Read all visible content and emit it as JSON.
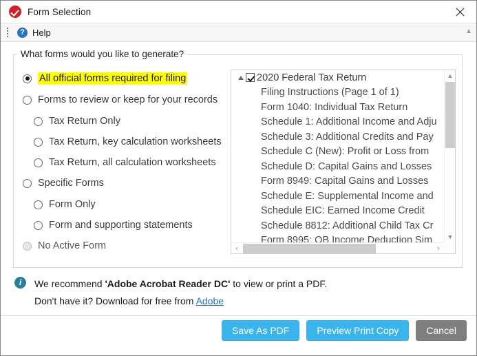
{
  "window": {
    "title": "Form Selection",
    "title_icon": "red-check-circle-icon",
    "close_icon": "close-icon"
  },
  "toolbar": {
    "grip_icon": "drag-grip-icon",
    "help_icon": "help-question-icon",
    "help_label": "Help",
    "collapse_icon": "chevron-up-icon"
  },
  "group": {
    "legend": "What forms would you like to generate?",
    "options": [
      {
        "label": "All official forms required for filing",
        "selected": true,
        "highlighted": true,
        "level": 0,
        "disabled": false
      },
      {
        "label": "Forms to review or keep for your records",
        "selected": false,
        "highlighted": false,
        "level": 0,
        "disabled": false
      },
      {
        "label": "Tax Return Only",
        "selected": false,
        "highlighted": false,
        "level": 1,
        "disabled": false
      },
      {
        "label": "Tax Return, key calculation worksheets",
        "selected": false,
        "highlighted": false,
        "level": 1,
        "disabled": false
      },
      {
        "label": "Tax Return, all calculation worksheets",
        "selected": false,
        "highlighted": false,
        "level": 1,
        "disabled": false
      },
      {
        "label": "Specific Forms",
        "selected": false,
        "highlighted": false,
        "level": 0,
        "disabled": false
      },
      {
        "label": "Form Only",
        "selected": false,
        "highlighted": false,
        "level": 1,
        "disabled": false
      },
      {
        "label": "Form and supporting statements",
        "selected": false,
        "highlighted": false,
        "level": 1,
        "disabled": false
      },
      {
        "label": "No Active Form",
        "selected": false,
        "highlighted": false,
        "level": 0,
        "disabled": true
      }
    ]
  },
  "forms_list": {
    "root": {
      "label": "2020 Federal Tax Return",
      "checked": true,
      "expanded": true,
      "expander_icon": "triangle-down-icon",
      "checkbox_icon": "checkbox-checked-icon"
    },
    "items": [
      "Filing Instructions (Page 1 of 1)",
      "Form 1040: Individual Tax Return",
      "Schedule 1: Additional Income and Adju",
      "Schedule 3: Additional Credits and Pay",
      "Schedule C (New): Profit or Loss from ",
      "Schedule D: Capital Gains and Losses",
      "Form 8949: Capital Gains and Losses",
      "Schedule E: Supplemental Income and",
      "Schedule EIC: Earned Income Credit",
      "Schedule 8812: Additional Child Tax Cr",
      "Form 8995: QB Income Deduction Sim"
    ],
    "scroll": {
      "up_icon": "scroll-up-arrow-icon",
      "down_icon": "scroll-down-arrow-icon",
      "left_icon": "scroll-left-arrow-icon",
      "right_icon": "scroll-right-arrow-icon"
    }
  },
  "info": {
    "icon": "info-icon",
    "line1_pre": "We recommend ",
    "line1_bold": "'Adobe Acrobat Reader DC'",
    "line1_post": " to view or print a PDF.",
    "line2_pre": "Don't have it? Download for free from ",
    "line2_link": "Adobe"
  },
  "footer": {
    "save_label": "Save As PDF",
    "preview_label": "Preview Print Copy",
    "cancel_label": "Cancel"
  },
  "colors": {
    "primary_button": "#3ab4ec",
    "cancel_button": "#7f7f7f",
    "highlight": "#ffff00",
    "title_icon": "#cc2229",
    "link": "#2a6fb5"
  }
}
